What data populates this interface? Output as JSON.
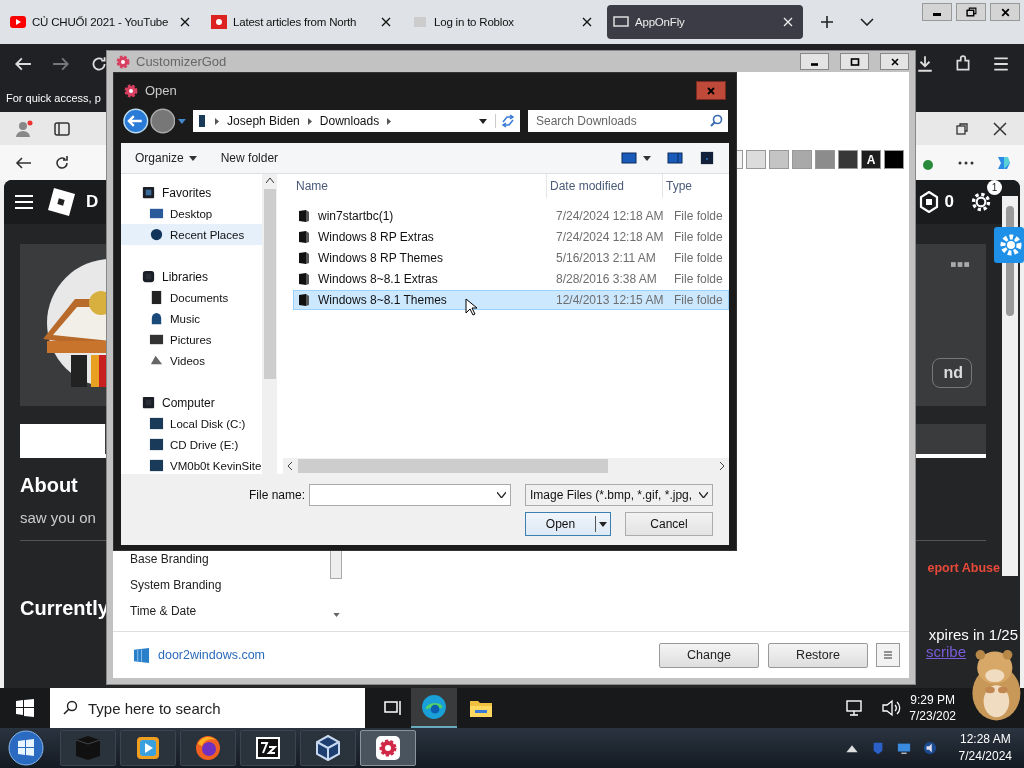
{
  "browser": {
    "tabs": [
      {
        "title": "CỦ CHUỐI 2021 - YouTube",
        "kind": "play",
        "selected": false
      },
      {
        "title": "Latest articles from North",
        "kind": "flag",
        "selected": false
      },
      {
        "title": "Log in to Roblox",
        "kind": "doc",
        "selected": false
      },
      {
        "title": "AppOnFly",
        "kind": "screen",
        "selected": true
      }
    ],
    "info_bar": "For quick access, p"
  },
  "roblox": {
    "header_text": "D",
    "robux": "0",
    "notifications": "1",
    "card_button": "nd",
    "about_title": "About",
    "about_text": "saw you on",
    "report": "eport Abuse",
    "currently": "Currently",
    "expires": "xpires in 1/25",
    "subscribe": "scribe"
  },
  "customizer": {
    "title": "CustomizerGod",
    "swatches": [
      {
        "color": "#f3f3f3"
      },
      {
        "color": "#dcdcdc"
      },
      {
        "color": "#c4c4c4"
      },
      {
        "color": "#a9a9a9"
      },
      {
        "color": "#8c8c8c"
      },
      {
        "color": "#383838"
      },
      {
        "color": "#1e1e1e",
        "label": "A"
      },
      {
        "color": "#000000"
      }
    ],
    "list": [
      "Base Branding",
      "System Branding",
      "Time & Date"
    ],
    "link": "door2windows.com",
    "buttons": [
      "Change",
      "Restore"
    ]
  },
  "open_dialog": {
    "title": "Open",
    "path": [
      "Joseph Biden",
      "Downloads"
    ],
    "search_placeholder": "Search Downloads",
    "organize": "Organize",
    "new_folder": "New folder",
    "nav": [
      {
        "label": "Favorites",
        "kind": "star",
        "selected": false,
        "children": [
          {
            "label": "Desktop",
            "kind": "desktop",
            "selected": false
          },
          {
            "label": "Recent Places",
            "kind": "recent",
            "selected": true
          }
        ]
      },
      {
        "label": "Libraries",
        "kind": "library",
        "selected": false,
        "children": [
          {
            "label": "Documents",
            "kind": "doc",
            "selected": false
          },
          {
            "label": "Music",
            "kind": "music",
            "selected": false
          },
          {
            "label": "Pictures",
            "kind": "pictures",
            "selected": false
          },
          {
            "label": "Videos",
            "kind": "videos",
            "selected": false
          }
        ]
      },
      {
        "label": "Computer",
        "kind": "computer",
        "selected": false,
        "children": [
          {
            "label": "Local Disk (C:)",
            "kind": "drive",
            "selected": false
          },
          {
            "label": "CD Drive (E:)",
            "kind": "drive",
            "selected": false
          },
          {
            "label": "VM0b0t KevinSite",
            "kind": "drive",
            "selected": false
          }
        ]
      }
    ],
    "columns": [
      "Name",
      "Date modified",
      "Type"
    ],
    "rows": [
      {
        "name": "win7startbc(1)",
        "date": "7/24/2024 12:18 AM",
        "type": "File folde",
        "selected": false
      },
      {
        "name": "Windows 8 RP Extras",
        "date": "7/24/2024 12:18 AM",
        "type": "File folde",
        "selected": false
      },
      {
        "name": "Windows 8 RP Themes",
        "date": "5/16/2013 2:11 AM",
        "type": "File folde",
        "selected": false
      },
      {
        "name": "Windows 8~8.1 Extras",
        "date": "8/28/2016 3:38 AM",
        "type": "File folde",
        "selected": false
      },
      {
        "name": "Windows 8~8.1 Themes",
        "date": "12/4/2013 12:15 AM",
        "type": "File folde",
        "selected": true
      }
    ],
    "file_name_label": "File name:",
    "file_type": "Image Files (*.bmp, *.gif, *.jpg,",
    "open": "Open",
    "cancel": "Cancel"
  },
  "taskbar": {
    "search_placeholder": "Type here to search",
    "time": "9:29 PM",
    "date": "7/23/202"
  },
  "system_taskbar": {
    "time": "12:28 AM",
    "date": "7/24/2024"
  }
}
